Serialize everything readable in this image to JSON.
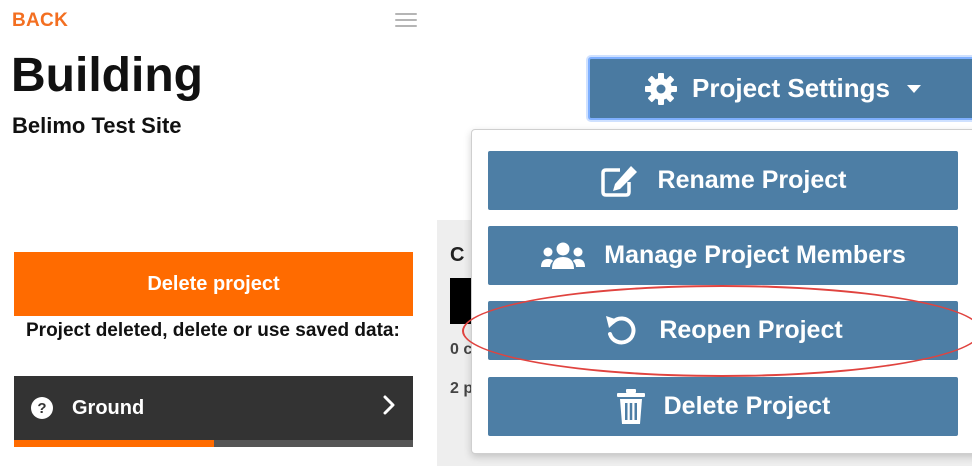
{
  "nav": {
    "back_label": "BACK"
  },
  "header": {
    "title": "Building",
    "subtitle": "Belimo Test Site"
  },
  "left_panel": {
    "delete_button_label": "Delete project",
    "deleted_message": "Project deleted, delete or use saved data:",
    "ground_item": {
      "label": "Ground",
      "progress_fraction": 0.5
    }
  },
  "background_panel": {
    "heading_fragment": "C",
    "line1_fragment": "0 c",
    "line2_fragment": "2 p"
  },
  "settings_menu": {
    "button_label": "Project Settings",
    "items": [
      {
        "label": "Rename Project",
        "icon": "edit-icon"
      },
      {
        "label": "Manage Project Members",
        "icon": "users-icon"
      },
      {
        "label": "Reopen Project",
        "icon": "undo-icon",
        "highlighted": true
      },
      {
        "label": "Delete Project",
        "icon": "trash-icon"
      }
    ]
  },
  "colors": {
    "accent_orange": "#ff6b00",
    "back_link": "#f36f21",
    "menu_blue": "#4d7ea5",
    "highlight_red": "#e0433f",
    "dark_row": "#333333"
  }
}
